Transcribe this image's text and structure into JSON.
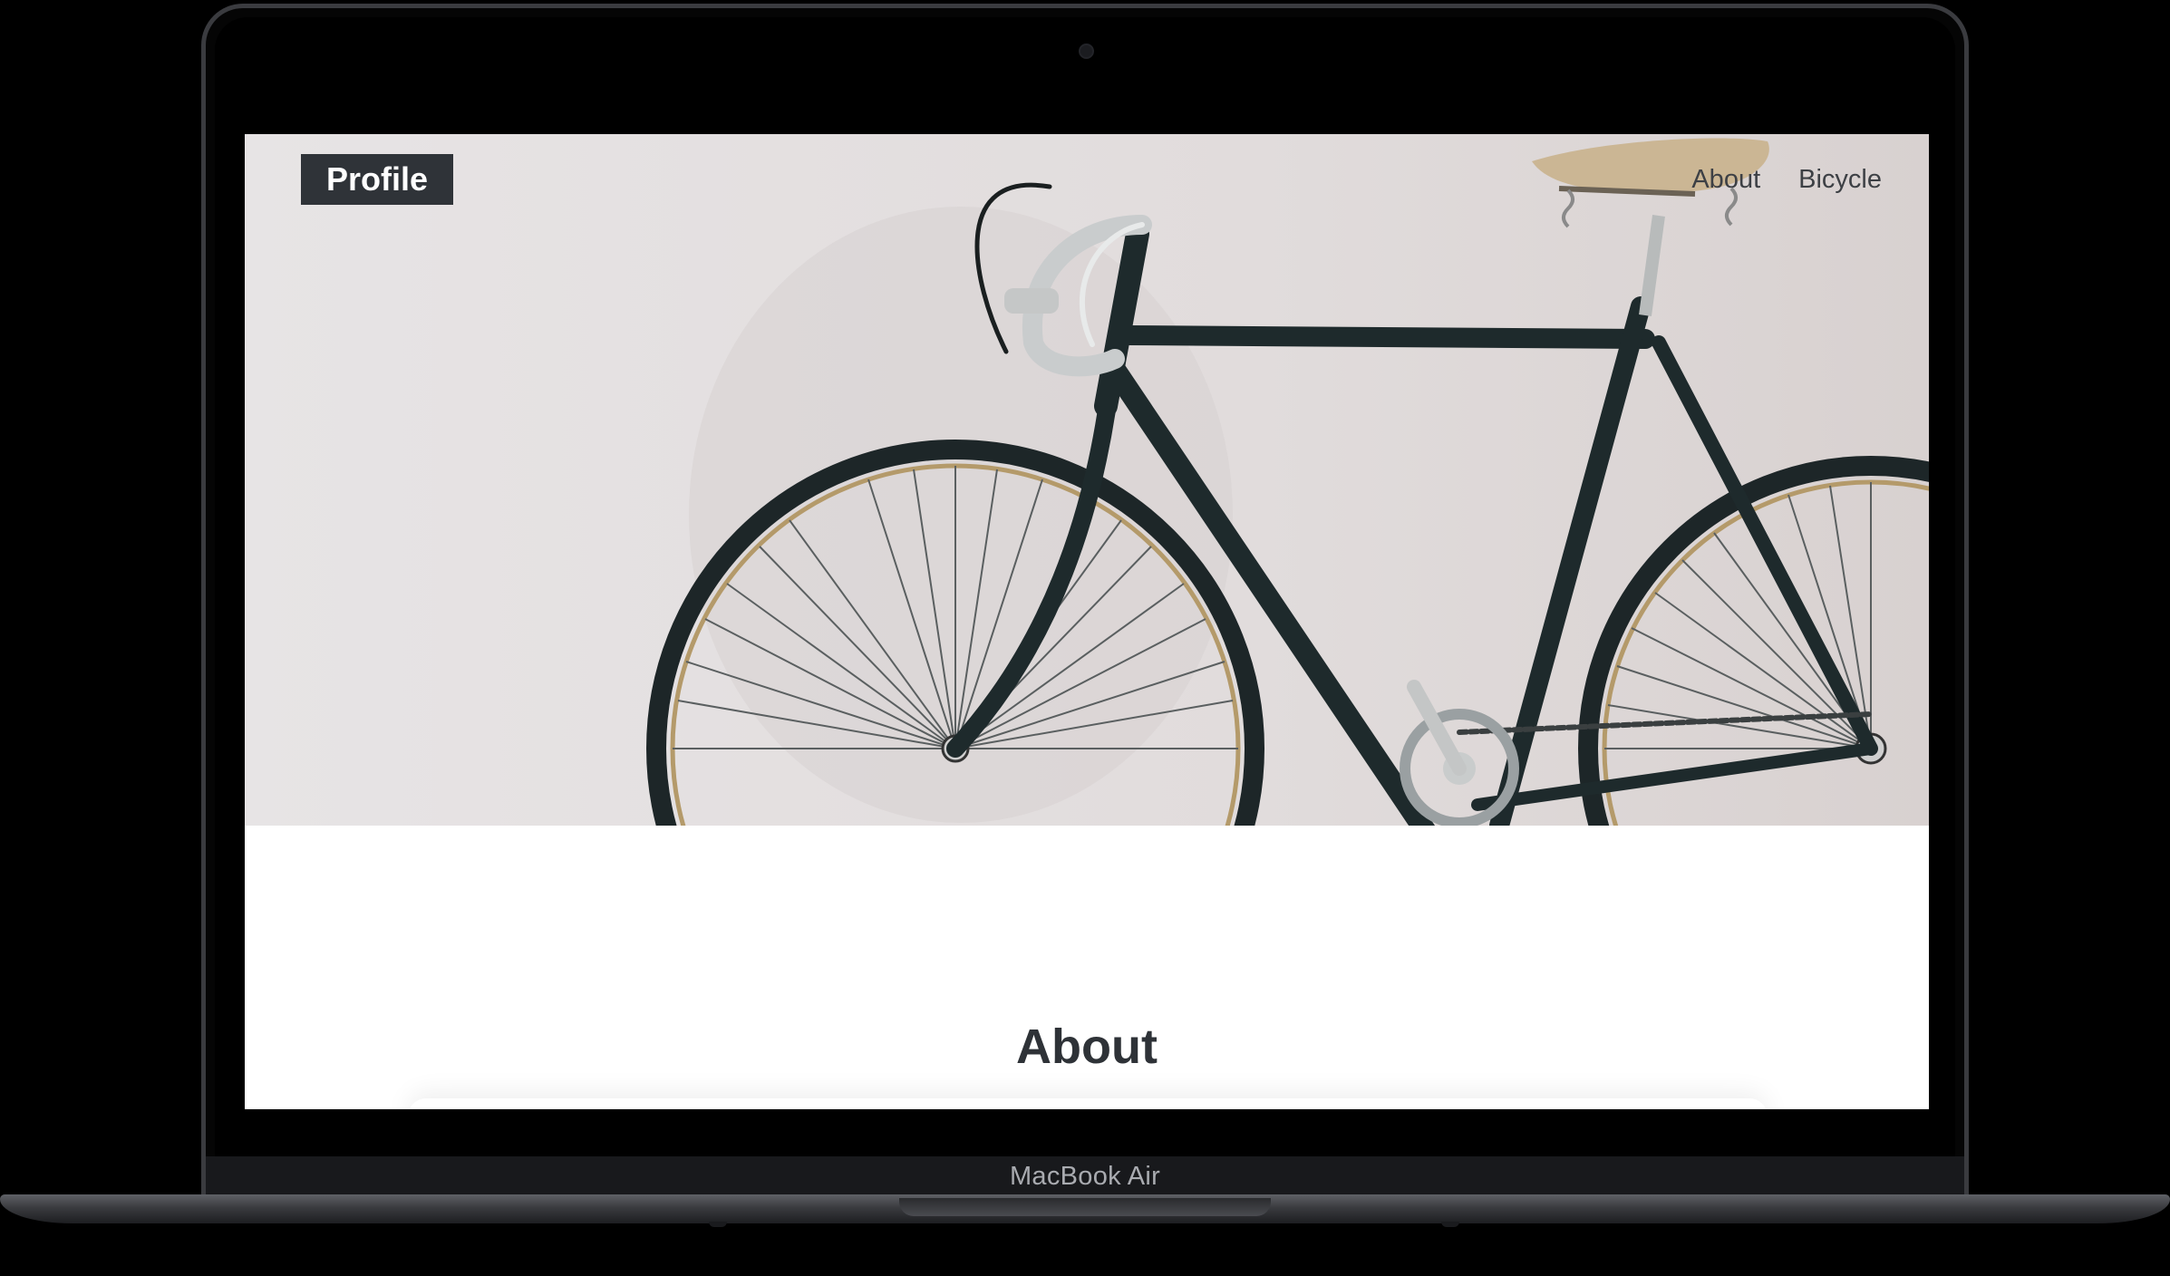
{
  "device": {
    "brand_label": "MacBook Air"
  },
  "site": {
    "logo": "Profile",
    "nav": [
      {
        "label": "About"
      },
      {
        "label": "Bicycle"
      }
    ]
  },
  "hero": {
    "image_subject": "bicycle-photo"
  },
  "sections": {
    "about_title": "About"
  },
  "colors": {
    "logo_bg": "#2f3338",
    "text": "#2e3237",
    "hero_bg": "#e2dedf",
    "bezel": "#050505"
  }
}
